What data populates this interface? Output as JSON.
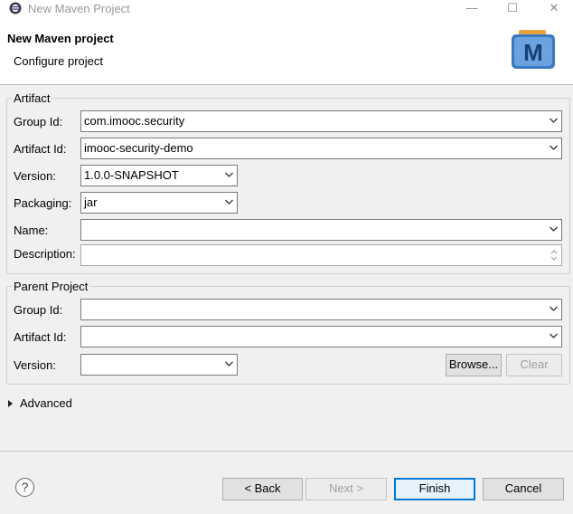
{
  "window": {
    "title": "New Maven Project",
    "minimize_glyph": "—",
    "maximize_glyph": "☐",
    "close_glyph": "✕"
  },
  "header": {
    "title": "New Maven project",
    "subtitle": "Configure project",
    "logo_letter": "M"
  },
  "artifact": {
    "legend": "Artifact",
    "group_id_label": "Group Id:",
    "group_id_value": "com.imooc.security",
    "artifact_id_label": "Artifact Id:",
    "artifact_id_value": "imooc-security-demo",
    "version_label": "Version:",
    "version_value": "1.0.0-SNAPSHOT",
    "packaging_label": "Packaging:",
    "packaging_value": "jar",
    "name_label": "Name:",
    "name_value": "",
    "description_label": "Description:",
    "description_value": ""
  },
  "parent": {
    "legend": "Parent Project",
    "group_id_label": "Group Id:",
    "group_id_value": "",
    "artifact_id_label": "Artifact Id:",
    "artifact_id_value": "",
    "version_label": "Version:",
    "version_value": "",
    "browse_label": "Browse...",
    "clear_label": "Clear"
  },
  "advanced": {
    "label": "Advanced",
    "expanded": false
  },
  "footer": {
    "help_glyph": "?",
    "back_label": "< Back",
    "next_label": "Next >",
    "finish_label": "Finish",
    "cancel_label": "Cancel"
  },
  "colors": {
    "accent": "#0078d7",
    "logo_blue": "#3b78c2",
    "logo_orange": "#e8a33d"
  },
  "icons": [
    "eclipse-app-icon",
    "maven-logo",
    "chevron-down-icon",
    "help-icon",
    "expand-triangle-icon"
  ]
}
